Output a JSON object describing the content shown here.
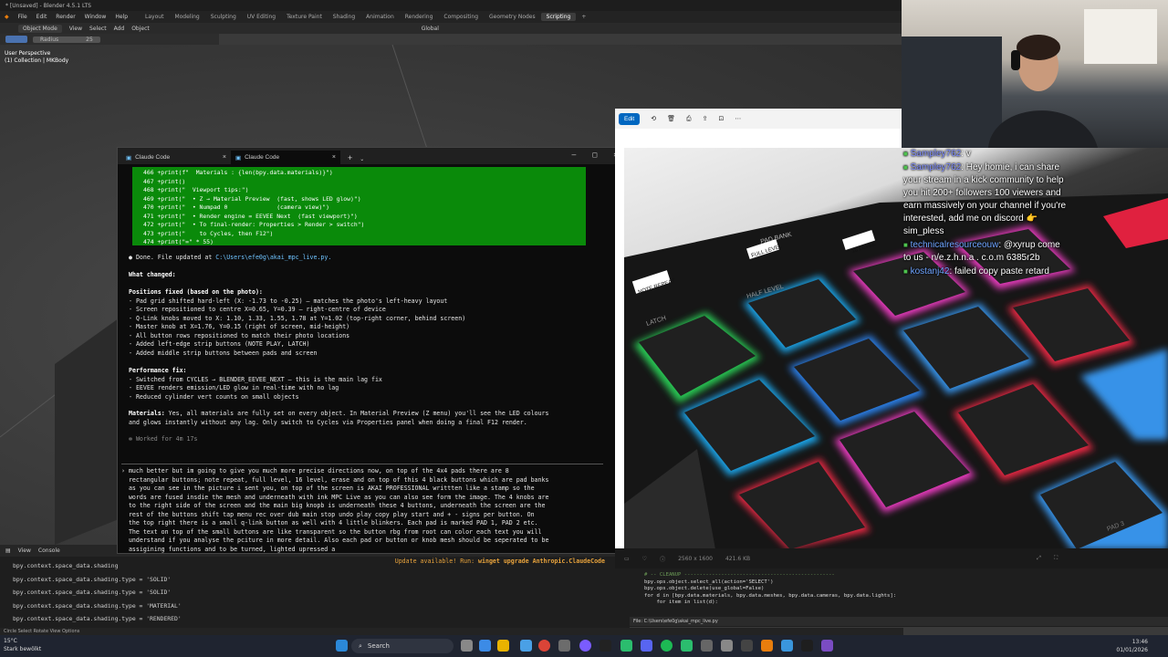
{
  "blender": {
    "title": "* [Unsaved] - Blender 4.5.1 LTS",
    "menu": [
      "File",
      "Edit",
      "Render",
      "Window",
      "Help"
    ],
    "workspaces": [
      "Layout",
      "Modeling",
      "Sculpting",
      "UV Editing",
      "Texture Paint",
      "Shading",
      "Animation",
      "Rendering",
      "Compositing",
      "Geometry Nodes",
      "Scripting"
    ],
    "active_workspace": "Scripting",
    "mode": "Object Mode",
    "header_items": [
      "View",
      "Select",
      "Add",
      "Object"
    ],
    "transform": "Global",
    "radius_label": "Radius",
    "radius_value": "25",
    "viewport_label": "User Perspective",
    "collection_label": "(1) Collection | MKBody",
    "console_tabs": [
      "View",
      "Console"
    ],
    "console_lines": [
      "bpy.context.space_data.shading",
      "bpy.context.space_data.shading.type = 'SOLID'",
      "bpy.context.space_data.shading.type = 'SOLID'",
      "bpy.context.space_data.shading.type = 'MATERIAL'",
      "bpy.context.space_data.shading.type = 'RENDERED'"
    ],
    "status_text": "Circle Select   Rotate View   Options"
  },
  "terminal": {
    "tabs": [
      "Claude Code",
      "Claude Code"
    ],
    "diff_lines": [
      "466 +print(f\"  Materials : {len(bpy.data.materials)}\")",
      "467 +print()",
      "468 +print(\"  Viewport tips:\")",
      "469 +print(\"  • Z → Material Preview  (fast, shows LED glow)\")",
      "470 +print(\"  • Numpad 0              (camera view)\")",
      "471 +print(\"  • Render engine = EEVEE Next  (fast viewport)\")",
      "472 +print(\"  • To final-render: Properties > Render > switch\")",
      "473 +print(\"    to Cycles, then F12\")",
      "474 +print(\"=\" * 55)"
    ],
    "done_prefix": "● Done. File updated at ",
    "done_path": "C:\\Users\\efe0g\\akai_mpc_live.py.",
    "what_changed": "What changed:",
    "positions_heading": "Positions fixed (based on the photo):",
    "positions": [
      "- Pad grid shifted hard-left (X: -1.73 to -0.25) — matches the photo's left-heavy layout",
      "- Screen repositioned to centre X=0.65, Y=0.39 — right-centre of device",
      "- Q-Link knobs moved to X: 1.10, 1.33, 1.55, 1.78 at Y=1.02 (top-right corner, behind screen)",
      "- Master knob at X=1.76, Y=0.15 (right of screen, mid-height)",
      "- All button rows repositioned to match their photo locations",
      "- Added left-edge strip buttons (NOTE PLAY, LATCH)",
      "- Added middle strip buttons between pads and screen"
    ],
    "perf_heading": "Performance fix:",
    "perf": [
      "- Switched from CYCLES → BLENDER_EEVEE_NEXT — this is the main lag fix",
      "- EEVEE renders emission/LED glow in real-time with no lag",
      "- Reduced cylinder vert counts on small objects"
    ],
    "materials_label": "Materials:",
    "materials_text": [
      " Yes, all materials are fully set on every object. In Material Preview (Z menu) you'll see the LED colours",
      "and glows instantly without any lag. Only switch to Cycles via Properties panel when doing a final F12 render."
    ],
    "worked": "✻ Worked for 4m 17s",
    "prompt_lines": [
      "› much better but im going to give you much more precise directions now, on top of the 4x4 pads there are 8",
      "  rectangular buttons; note repeat, full level, 16 level, erase and on top of this 4 black buttons which are pad banks",
      "  as you can see in the picture i sent you, on top of the screen is AKAI PROFESSIONAL writtten like a stamp so the",
      "  words are fused insdie the mesh and underneath with ink MPC Live as you can also see form the image. The 4 knobs are",
      "  to the right side of the screen and the main big knopb is underneath these 4 buttons, underneath the screen are the",
      "  rest of the buttons shift tap menu rec over dub main stop undo play copy play start and + - signs per button. On",
      "  the top right there is a small q-link button as well with 4 little blinkers. Each pad is marked PAD 1, PAD 2 etc.",
      "  The text on top of the small buttons are like transparent so the button rbg from root can color each text you will",
      "  understand if you analyse the pciture in more detail. Also each pad or button or knob mesh should be seperated to be",
      "  assigining functions and to be turned, lighted upressed a"
    ],
    "update_prefix": "Update available! Run: ",
    "update_cmd": "winget upgrade Anthropic.ClaudeCode"
  },
  "photo_viewer": {
    "edit_label": "Edit",
    "dimensions": "2560 x 1600",
    "size": "421.6 KB",
    "labels": [
      "PAD BANK",
      "16 LEVEL",
      "FULL LEVEL",
      "HALF LEVEL",
      "NOTE REPEAT",
      "LATCH",
      "PAD 3"
    ]
  },
  "code_editor": {
    "lines": [
      "# -- CLEANUP -------------------------------------------------",
      "bpy.ops.object.select_all(action='SELECT')",
      "bpy.ops.object.delete(use_global=False)",
      "for d in [bpy.data.materials, bpy.data.meshes, bpy.data.cameras, bpy.data.lights]:",
      "    for item in list(d):"
    ],
    "file_path": "File: C:\\Users\\efe0g\\akai_mpc_live.py"
  },
  "chat": [
    {
      "user": "Sampley762",
      "text": ": v"
    },
    {
      "user": "Sampley762",
      "text": ": Hey homie, i can share your stream in a kick community to help you hit 200+ followers 100 viewers and earn massively on your channel if you're interested, add me on discord 👉 sim_pless"
    },
    {
      "user": "technicalresourceouw",
      "text": ": @xyrup come to us - n/e.z.h.n.a . c.o.m 6385r2b"
    },
    {
      "user": "kostanj42",
      "text": ": failed copy paste retard"
    }
  ],
  "taskbar": {
    "weather_temp": "15°C",
    "weather_desc": "Stark bewölkt",
    "search": "Search",
    "time": "13:46",
    "date": "01/01/2026"
  }
}
